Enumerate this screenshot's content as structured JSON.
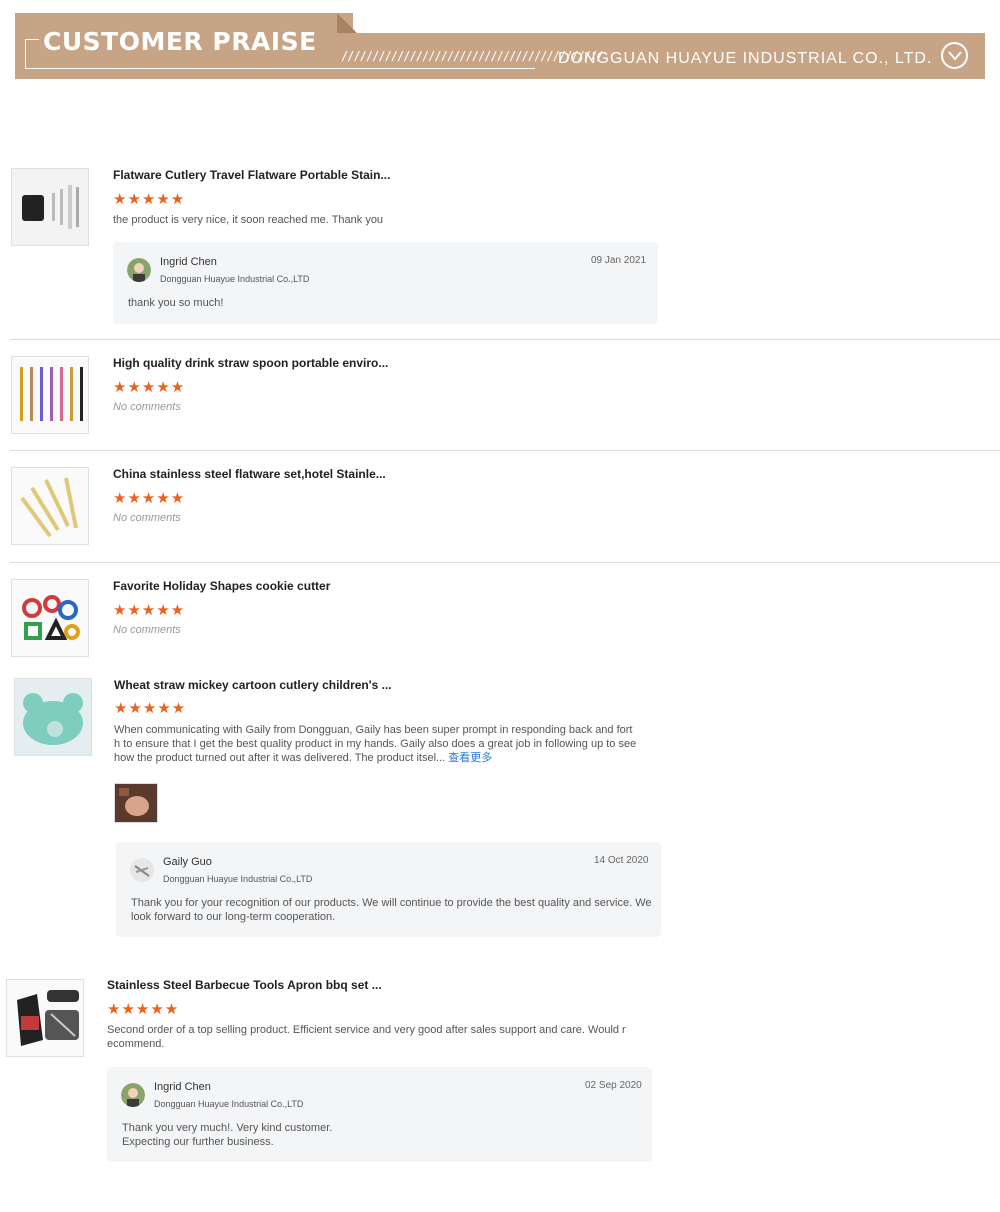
{
  "header": {
    "title": "CUSTOMER PRAISE",
    "slashes": "//////////////////////////////////////////",
    "company": "DONGGUAN HUAYUE INDUSTRIAL CO., LTD."
  },
  "colors": {
    "banner": "#c8a487",
    "star": "#e9631e",
    "link": "#2a7ad5"
  },
  "reviews": [
    {
      "title": "Flatware Cutlery Travel Flatware Portable Stain...",
      "stars": "★★★★★",
      "comment": "the product is very nice, it soon reached me. Thank you",
      "reply": {
        "name": "Ingrid Chen",
        "company": "Dongguan Huayue Industrial Co.,LTD",
        "date": "09 Jan 2021",
        "text": "thank you so much!"
      }
    },
    {
      "title": "High quality drink straw spoon portable enviro...",
      "stars": "★★★★★",
      "comment": "No comments"
    },
    {
      "title": "China stainless steel flatware set,hotel Stainle...",
      "stars": "★★★★★",
      "comment": "No comments"
    },
    {
      "title": "Favorite Holiday Shapes cookie cutter",
      "stars": "★★★★★",
      "comment": "No comments"
    },
    {
      "title": "Wheat straw mickey cartoon cutlery children's ...",
      "stars": "★★★★★",
      "comment_lines": [
        "When communicating with Gaily from Dongguan, Gaily has been super prompt in responding back and fort",
        "h to ensure that I get the best quality product in my hands. Gaily also does a great job in following up to see",
        "how the product turned out after it was delivered. The product itsel..."
      ],
      "more": "查看更多",
      "reply": {
        "name": "Gaily Guo",
        "company": "Dongguan Huayue Industrial Co.,LTD",
        "date": "14 Oct 2020",
        "text_lines": [
          "Thank you for your recognition of our products. We will continue to provide the best quality and service. We",
          "look forward to our long-term cooperation."
        ]
      }
    },
    {
      "title": "Stainless Steel Barbecue Tools Apron bbq set ...",
      "stars": "★★★★★",
      "comment_lines": [
        "Second order of a top selling product. Efficient service and very good after sales support and care. Would r",
        "ecommend."
      ],
      "reply": {
        "name": "Ingrid Chen",
        "company": "Dongguan Huayue Industrial Co.,LTD",
        "date": "02 Sep 2020",
        "text_lines": [
          "Thank you very much!. Very kind customer.",
          "Expecting our further business."
        ]
      }
    }
  ]
}
